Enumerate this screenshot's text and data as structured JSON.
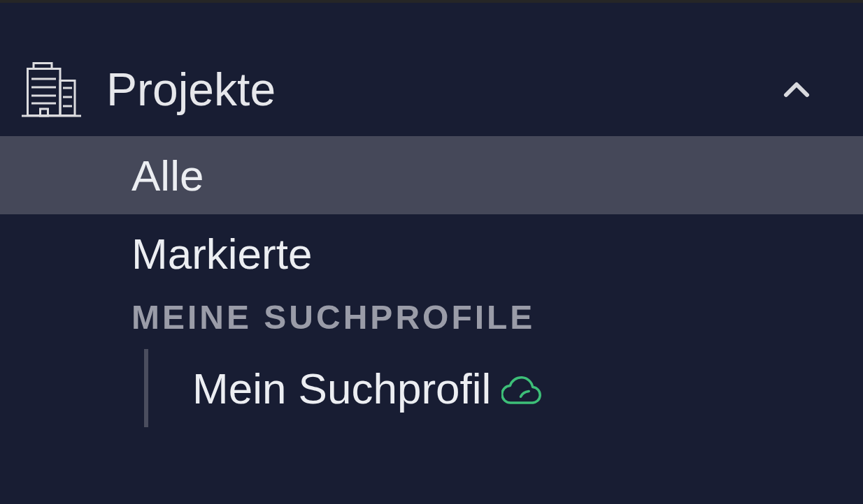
{
  "sidebar": {
    "section": {
      "title": "Projekte",
      "expanded": true
    },
    "items": [
      {
        "label": "Alle",
        "selected": true
      },
      {
        "label": "Markierte",
        "selected": false
      }
    ],
    "search_profiles": {
      "heading": "MEINE SUCHPROFILE",
      "items": [
        {
          "label": "Mein Suchprofil",
          "selected": false
        }
      ]
    }
  }
}
